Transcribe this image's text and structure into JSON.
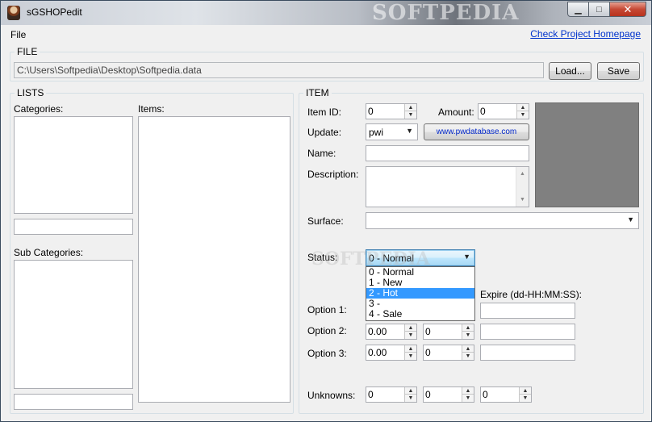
{
  "window": {
    "title": "sGSHOPedit",
    "watermark": "SOFTPEDIA",
    "min_symbol": "▁",
    "max_symbol": "□",
    "close_symbol": "✕"
  },
  "menu": {
    "file": "File",
    "home_link": "Check Project Homepage"
  },
  "file_group": {
    "title": "FILE",
    "path": "C:\\Users\\Softpedia\\Desktop\\Softpedia.data",
    "load_label": "Load...",
    "save_label": "Save"
  },
  "lists": {
    "title": "LISTS",
    "categories_label": "Categories:",
    "items_label": "Items:",
    "subcategories_label": "Sub Categories:"
  },
  "item": {
    "title": "ITEM",
    "item_id_label": "Item ID:",
    "item_id": "0",
    "amount_label": "Amount:",
    "amount": "0",
    "update_label": "Update:",
    "update_value": "pwi",
    "pwdb_link": "www.pwdatabase.com",
    "name_label": "Name:",
    "description_label": "Description:",
    "surface_label": "Surface:",
    "status_label": "Status:",
    "status_value": "0 - Normal",
    "status_options": [
      "0 - Normal",
      "1 - New",
      "2 - Hot",
      "3 -",
      "4 - Sale"
    ],
    "status_selected_index": 2,
    "expire_label": "Expire (dd-HH:MM:SS):",
    "option1_label": "Option 1:",
    "option2_label": "Option 2:",
    "option2_price": "0.00",
    "option2_count": "0",
    "option3_label": "Option 3:",
    "option3_price": "0.00",
    "option3_count": "0",
    "unknowns_label": "Unknowns:",
    "unknown1": "0",
    "unknown2": "0",
    "unknown3": "0"
  },
  "icons": {
    "up_arrow": "▲",
    "down_arrow": "▼"
  },
  "colors": {
    "selection": "#3399ff",
    "link": "#0033cc",
    "preview": "#808080"
  }
}
